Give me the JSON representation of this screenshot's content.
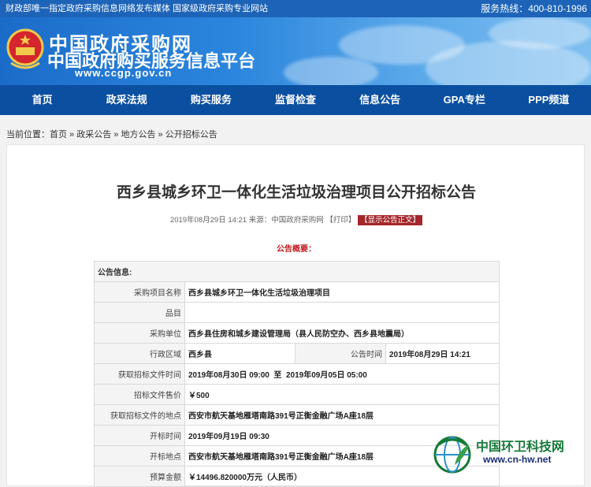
{
  "topbar": {
    "left_text": "财政部唯一指定政府采购信息网络发布媒体 国家级政府采购专业网站",
    "hotline": "服务热线：400-810-1996"
  },
  "logo": {
    "line1": "中国政府采购网",
    "line2": "中国政府购买服务信息平台",
    "url": "www.ccgp.gov.cn"
  },
  "nav": [
    "首页",
    "政采法规",
    "购买服务",
    "监督检查",
    "信息公告",
    "GPA专栏",
    "PPP频道"
  ],
  "breadcrumb": {
    "prefix": "当前位置：",
    "items": [
      "首页",
      "政采公告",
      "地方公告",
      "公开招标公告"
    ],
    "sep": " » "
  },
  "article": {
    "title": "西乡县城乡环卫一体化生活垃圾治理项目公开招标公告",
    "date": "2019年08月29日 14:21",
    "source": "来源：中国政府采购网",
    "print": "【打印】",
    "show_body": "【显示公告正文】",
    "overview_label": "公告概要："
  },
  "notice_table": {
    "header": "公告信息:",
    "project_name_label": "采购项目名称",
    "project_name": "西乡县城乡环卫一体化生活垃圾治理项目",
    "item_label": "品目",
    "item": "",
    "buyer_label": "采购单位",
    "buyer": "西乡县住房和城乡建设管理局（县人民防空办、西乡县地震局）",
    "region_label": "行政区域",
    "region": "西乡县",
    "pubtime_label": "公告时间",
    "pubtime": "2019年08月29日 14:21",
    "get_doc_time_label": "获取招标文件时间",
    "get_doc_time": "2019年08月30日 09:00  至  2019年09月05日 05:00",
    "doc_price_label": "招标文件售价",
    "doc_price": "￥500",
    "get_doc_place_label": "获取招标文件的地点",
    "get_doc_place": "西安市航天基地雁塔南路391号正衡金融广场A座18层",
    "open_time_label": "开标时间",
    "open_time": "2019年09月19日 09:30",
    "open_place_label": "开标地点",
    "open_place": "西安市航天基地雁塔南路391号正衡金融广场A座18层",
    "budget_label": "预算金额",
    "budget": "￥14496.820000万元（人民币）"
  },
  "watermark": {
    "name": "中国环卫科技网",
    "url": "www.cn-hw.net"
  },
  "colors": {
    "nav_bg": "#0b4fa0",
    "topbar_bg": "#1d64b8",
    "accent_red": "#c3191f",
    "button_red": "#a4272b",
    "watermark_green": "#177a3a"
  }
}
